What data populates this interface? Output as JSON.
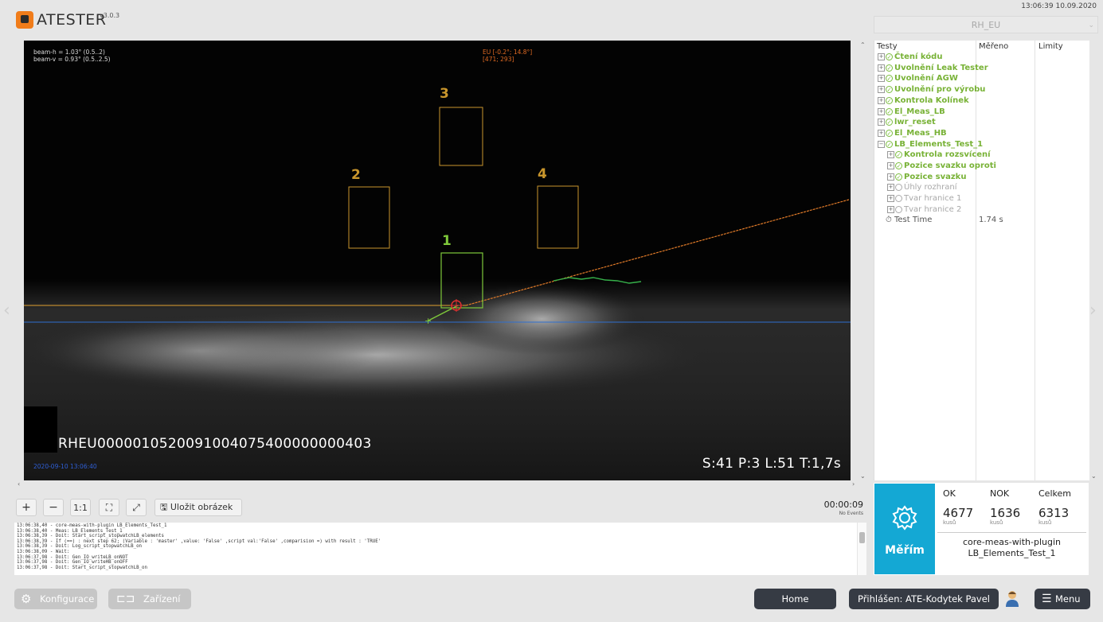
{
  "app": {
    "name": "ATESTER",
    "version": "v3.0.3"
  },
  "clock": "13:06:39 10.09.2020",
  "variant": "RH_EU",
  "viewport": {
    "beam_h": "beam-h = 1.03° (0.5..2)",
    "beam_v": "beam-v = 0.93° (0.5..2.5)",
    "eu_line1": "EU [-0.2°; 14.8°]",
    "eu_line2": "[471; 293]",
    "zones": [
      "1",
      "2",
      "3",
      "4"
    ],
    "serial": "RHEU0000010520091004075400000000403",
    "date_stamp": "2020-09-10 13:06:40",
    "stats": "S:41  P:3  L:51  T:1,7s"
  },
  "tree": {
    "headers": [
      "Testy",
      "Měřeno",
      "Limity"
    ],
    "items": [
      {
        "label": "Čtení kódu",
        "status": "ok",
        "level": 0
      },
      {
        "label": "Uvolnění Leak Tester",
        "status": "ok",
        "level": 0
      },
      {
        "label": "Uvolnění AGW",
        "status": "ok",
        "level": 0
      },
      {
        "label": "Uvolnění pro výrobu",
        "status": "ok",
        "level": 0
      },
      {
        "label": "Kontrola Kolínek",
        "status": "ok",
        "level": 0
      },
      {
        "label": "El_Meas_LB",
        "status": "ok",
        "level": 0
      },
      {
        "label": "lwr_reset",
        "status": "ok",
        "level": 0
      },
      {
        "label": "El_Meas_HB",
        "status": "ok",
        "level": 0
      },
      {
        "label": "LB_Elements_Test_1",
        "status": "ok",
        "level": 0
      },
      {
        "label": "Kontrola rozsvícení",
        "status": "ok",
        "level": 1
      },
      {
        "label": "Pozice svazku oproti",
        "status": "ok",
        "level": 1
      },
      {
        "label": "Pozice svazku",
        "status": "ok",
        "level": 1
      },
      {
        "label": "Úhly rozhraní",
        "status": "pending",
        "level": 1
      },
      {
        "label": "Tvar hranice 1",
        "status": "pending",
        "level": 1
      },
      {
        "label": "Tvar hranice 2",
        "status": "pending",
        "level": 1
      }
    ],
    "test_time_label": "Test Time",
    "test_time_value": "1.74 s"
  },
  "toolbar": {
    "zoom_in": "+",
    "zoom_out": "−",
    "one_to_one": "1:1",
    "save_image": "Uložit obrázek",
    "elapsed": "00:00:09",
    "events": "No Events"
  },
  "log": [
    "13:06:38,40 - core-meas-with-plugin  LB_Elements_Test_1",
    "13:06:38,40 - Meas: LB_Elements_Test_1",
    "13:06:38,39 - Doit: Start_script_stopwatchLB_elements",
    "13:06:38,39 - If (==) : next step 62; (Variable : 'master'  ,value: 'False' ,script val:'False' ,comparision =)  with result : 'TRUE'",
    "13:06:38,39 - Doit: Log_script_stopwatchLB_on",
    "13:06:38,09 - Wait:",
    "13:06:37,98 - Doit: Gen_IO_writeLB_onNOT",
    "13:06:37,98 - Doit: Gen_IO_writeHB_onOFF",
    "13:06:37,98 - Doit: Start_script_stopwatchLB_on"
  ],
  "counters": {
    "ok_label": "OK",
    "ok_value": "4677",
    "ok_unit": "kusů",
    "nok_label": "NOK",
    "nok_value": "1636",
    "nok_unit": "kusů",
    "total_label": "Celkem",
    "total_value": "6313",
    "total_unit": "kusů"
  },
  "measure": {
    "label": "Měřím",
    "script": "core-meas-with-plugin",
    "test": "LB_Elements_Test_1"
  },
  "bottom": {
    "config": "Konfigurace",
    "device": "Zařízení",
    "home": "Home",
    "login": "Přihlášen: ATE-Kodytek Pavel",
    "menu": "Menu"
  },
  "colors": {
    "accent": "#14a8d4",
    "ok": "#78b236",
    "brand": "#f07c1a",
    "dark_button": "#363b44"
  }
}
